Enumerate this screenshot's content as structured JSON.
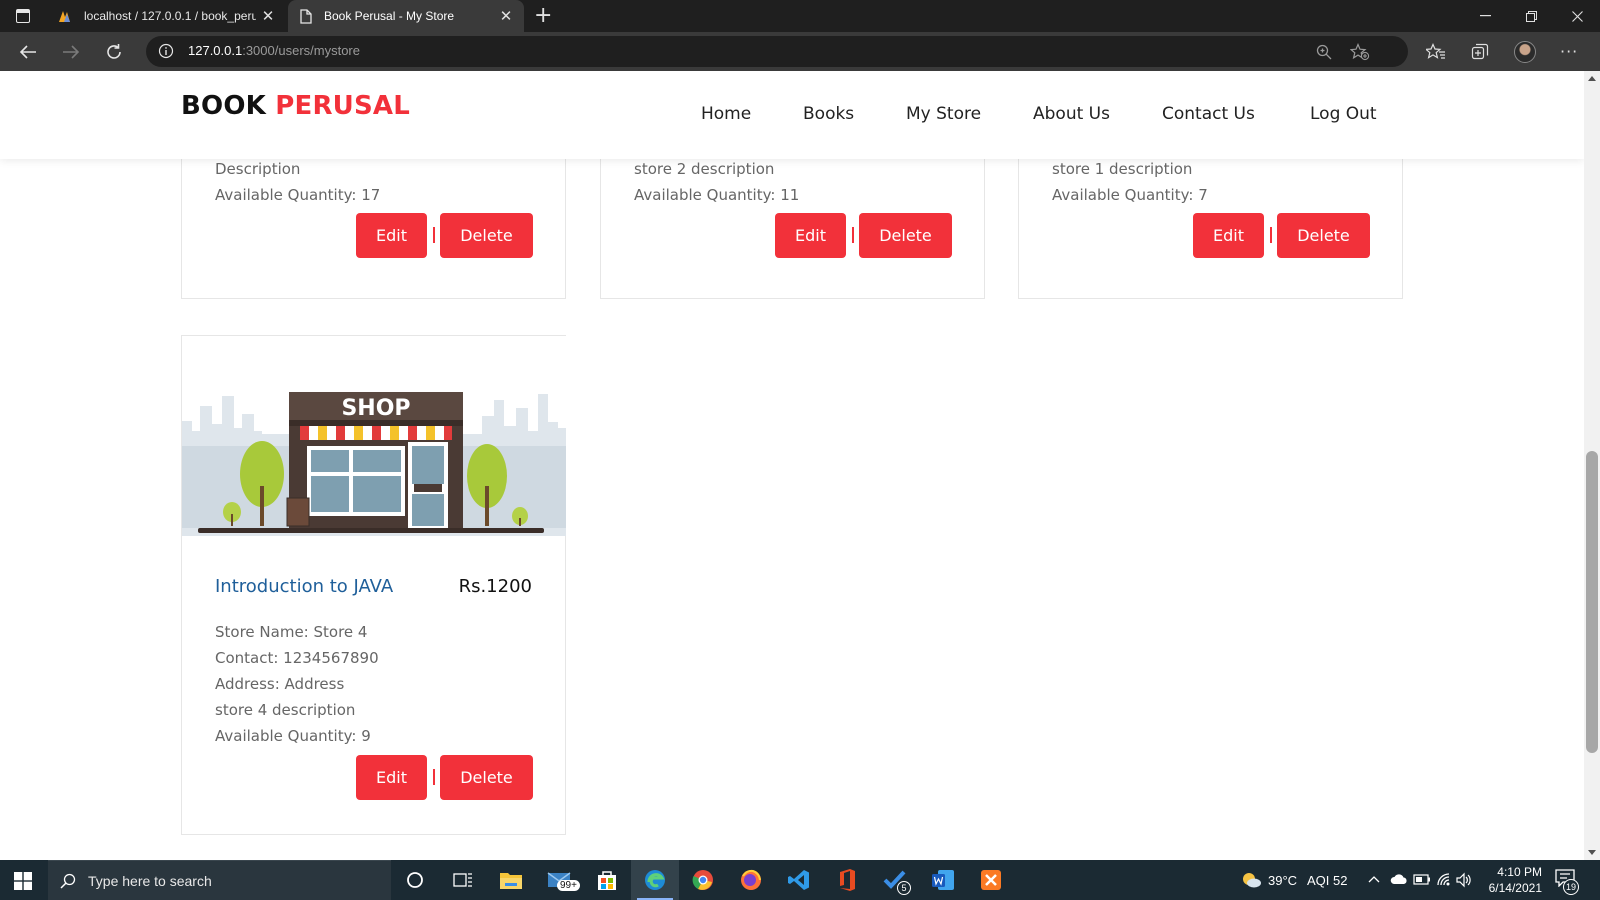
{
  "browser": {
    "tabs": [
      {
        "title": "localhost / 127.0.0.1 / book_peru",
        "icon": "phpmyadmin-icon"
      },
      {
        "title": "Book Perusal - My Store",
        "icon": "page-icon",
        "active": true
      }
    ],
    "url_host": "127.0.0.1",
    "url_rest": ":3000/users/mystore"
  },
  "site": {
    "logo_main": "BOOK",
    "logo_accent": "PERUSAL",
    "accent_color": "#f2313a",
    "nav": [
      "Home",
      "Books",
      "My Store",
      "About Us",
      "Contact Us",
      "Log Out"
    ]
  },
  "cards_top": [
    {
      "description": "Description",
      "quantity": "Available Quantity: 17",
      "edit": "Edit",
      "delete": "Delete"
    },
    {
      "description": "store 2 description",
      "quantity": "Available Quantity: 11",
      "edit": "Edit",
      "delete": "Delete"
    },
    {
      "description": "store 1 description",
      "quantity": "Available Quantity: 7",
      "edit": "Edit",
      "delete": "Delete"
    }
  ],
  "card_main": {
    "image_label": "SHOP",
    "title": "Introduction to JAVA",
    "price": "Rs.1200",
    "store_name": "Store Name: Store 4",
    "contact": "Contact: 1234567890",
    "address": "Address: Address",
    "description": "store 4 description",
    "quantity": "Available Quantity: 9",
    "edit": "Edit",
    "delete": "Delete"
  },
  "taskbar": {
    "search_placeholder": "Type here to search",
    "mail_badge": "99+",
    "todo_badge": "5",
    "weather": "39°C",
    "aqi": "AQI 52",
    "time": "4:10 PM",
    "date": "6/14/2021",
    "notifications": "19"
  }
}
